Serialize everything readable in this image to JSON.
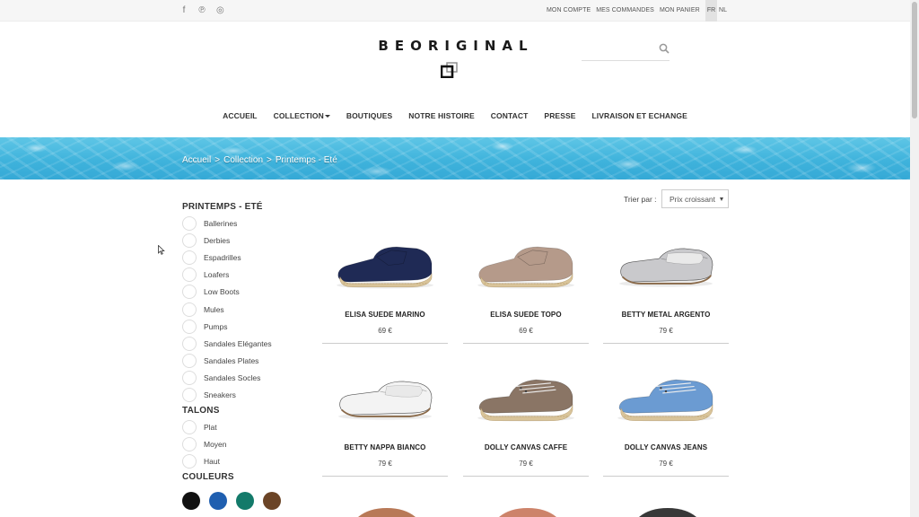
{
  "topbar": {
    "social": [
      {
        "icon": "facebook-icon",
        "glyph": "f"
      },
      {
        "icon": "pinterest-icon",
        "glyph": "℗"
      },
      {
        "icon": "instagram-icon",
        "glyph": "◎"
      }
    ],
    "links": [
      "MON COMPTE",
      "MES COMMANDES",
      "MON PANIER"
    ],
    "languages": [
      "FR",
      "NL"
    ],
    "active_language": "FR"
  },
  "header": {
    "logo": "BEORIGINAL",
    "search_placeholder": ""
  },
  "nav": {
    "items": [
      "ACCUEIL",
      "COLLECTION",
      "BOUTIQUES",
      "NOTRE HISTOIRE",
      "CONTACT",
      "PRESSE",
      "LIVRAISON ET ECHANGE"
    ]
  },
  "breadcrumb": {
    "items": [
      "Accueil",
      "Collection",
      "Printemps - Eté"
    ],
    "separator": ">"
  },
  "sidebar": {
    "category_title": "PRINTEMPS - ETÉ",
    "categories": [
      "Ballerines",
      "Derbies",
      "Espadrilles",
      "Loafers",
      "Low Boots",
      "Mules",
      "Pumps",
      "Sandales Elégantes",
      "Sandales Plates",
      "Sandales Socles",
      "Sneakers"
    ],
    "heels_title": "TALONS",
    "heels": [
      "Plat",
      "Moyen",
      "Haut"
    ],
    "colors_title": "COULEURS",
    "colors": [
      "#111111",
      "#1f5fb0",
      "#137a6a",
      "#6b4426"
    ]
  },
  "sort": {
    "label": "Trier par :",
    "selected": "Prix croissant"
  },
  "products": [
    {
      "name": "ELISA SUEDE MARINO",
      "price": "69 €",
      "color": "#1f2a55",
      "type": "espadrille"
    },
    {
      "name": "ELISA SUEDE TOPO",
      "price": "69 €",
      "color": "#b59a8a",
      "type": "espadrille"
    },
    {
      "name": "BETTY METAL ARGENTO",
      "price": "79 €",
      "color": "#c9c9cc",
      "type": "loafer"
    },
    {
      "name": "BETTY NAPPA BIANCO",
      "price": "79 €",
      "color": "#f3f3f3",
      "type": "loafer"
    },
    {
      "name": "DOLLY CANVAS CAFFE",
      "price": "79 €",
      "color": "#8a7565",
      "type": "mule"
    },
    {
      "name": "DOLLY CANVAS JEANS",
      "price": "79 €",
      "color": "#6b9bd2",
      "type": "mule"
    }
  ],
  "partial_products": [
    {
      "color": "#b06a45"
    },
    {
      "color": "#c8765a"
    },
    {
      "color": "#222222"
    }
  ]
}
